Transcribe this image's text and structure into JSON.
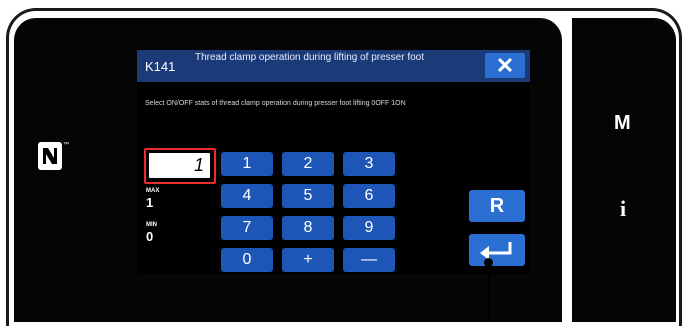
{
  "device": {
    "side_keys": {
      "mode": "M",
      "info": "i"
    },
    "nfc_mark": "N",
    "nfc_tm": "™"
  },
  "dialog": {
    "code": "K141",
    "title": "Thread clamp operation during lifting of presser foot",
    "close_symbol": "✕",
    "instruction": "Select ON/OFF stats of thread clamp operation during presser foot lifting 0OFF 1ON",
    "value": "1",
    "max_label": "MAX",
    "max_value": "1",
    "min_label": "MIN",
    "min_value": "0",
    "keys": [
      "1",
      "2",
      "3",
      "4",
      "5",
      "6",
      "7",
      "8",
      "9",
      "0",
      "+",
      "—"
    ],
    "reset_label": "R"
  },
  "colors": {
    "title_bar": "#1b3a78",
    "keypad": "#1e56b8",
    "accent": "#2b6fd3",
    "highlight": "#ee2a2a"
  }
}
